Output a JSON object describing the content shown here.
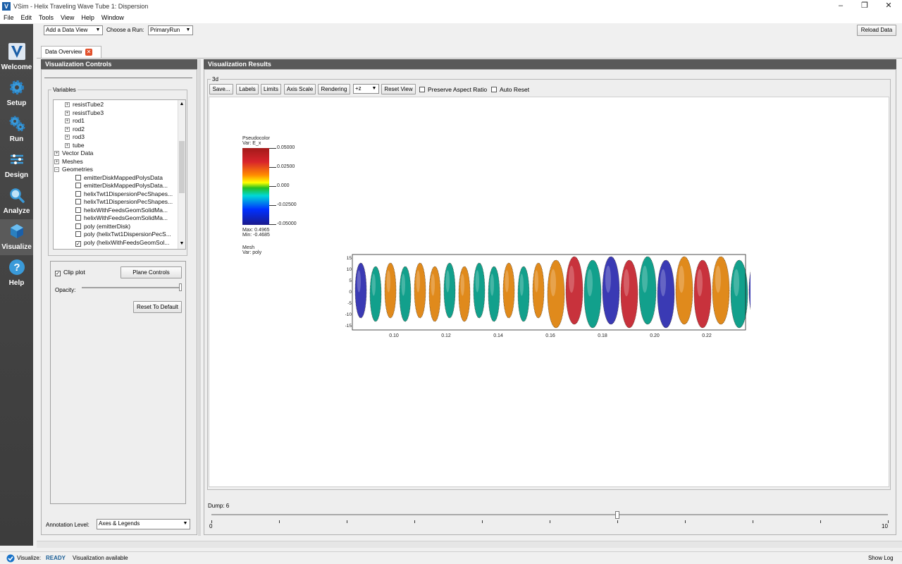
{
  "window": {
    "title": "VSim - Helix Traveling Wave Tube 1: Dispersion"
  },
  "menu": [
    "File",
    "Edit",
    "Tools",
    "View",
    "Help",
    "Window"
  ],
  "nav": [
    {
      "label": "Welcome",
      "icon": "vsim-logo-icon"
    },
    {
      "label": "Setup",
      "icon": "gear-icon"
    },
    {
      "label": "Run",
      "icon": "gears-icon"
    },
    {
      "label": "Design",
      "icon": "design-icon"
    },
    {
      "label": "Analyze",
      "icon": "magnifier-icon"
    },
    {
      "label": "Visualize",
      "icon": "cube-icon"
    },
    {
      "label": "Help",
      "icon": "question-icon"
    }
  ],
  "toolbar": {
    "add_data_view": "Add a Data View",
    "choose_run_label": "Choose a Run:",
    "run_value": "PrimaryRun",
    "reload": "Reload Data"
  },
  "tab": {
    "label": "Data Overview"
  },
  "controls": {
    "header": "Visualization Controls",
    "variables_title": "Variables",
    "tree": [
      {
        "label": "resistTube2",
        "type": "expand",
        "indent": 2
      },
      {
        "label": "resistTube3",
        "type": "expand",
        "indent": 2
      },
      {
        "label": "rod1",
        "type": "expand",
        "indent": 2
      },
      {
        "label": "rod2",
        "type": "expand",
        "indent": 2
      },
      {
        "label": "rod3",
        "type": "expand",
        "indent": 2
      },
      {
        "label": "tube",
        "type": "expand",
        "indent": 2
      },
      {
        "label": "Vector Data",
        "type": "expand",
        "indent": 0
      },
      {
        "label": "Meshes",
        "type": "expand",
        "indent": 0
      },
      {
        "label": "Geometries",
        "type": "collapse",
        "indent": 0
      },
      {
        "label": "emitterDiskMappedPolysData",
        "type": "check",
        "indent": 3,
        "checked": false
      },
      {
        "label": "emitterDiskMappedPolysData...",
        "type": "check",
        "indent": 3,
        "checked": false
      },
      {
        "label": "helixTwt1DispersionPecShapes...",
        "type": "check",
        "indent": 3,
        "checked": false
      },
      {
        "label": "helixTwt1DispersionPecShapes...",
        "type": "check",
        "indent": 3,
        "checked": false
      },
      {
        "label": "helixWithFeedsGeomSolidMa...",
        "type": "check",
        "indent": 3,
        "checked": false
      },
      {
        "label": "helixWithFeedsGeomSolidMa...",
        "type": "check",
        "indent": 3,
        "checked": false
      },
      {
        "label": "poly (emitterDisk)",
        "type": "check",
        "indent": 3,
        "checked": false
      },
      {
        "label": "poly (helixTwt1DispersionPecS...",
        "type": "check",
        "indent": 3,
        "checked": false
      },
      {
        "label": "poly (helixWithFeedsGeomSol...",
        "type": "check",
        "indent": 3,
        "checked": true
      }
    ],
    "clip_plot": "Clip plot",
    "plane_controls": "Plane Controls",
    "opacity_label": "Opacity:",
    "reset_default": "Reset To Default",
    "annotation_label": "Annotation Level:",
    "annotation_value": "Axes & Legends"
  },
  "results": {
    "header": "Visualization Results",
    "group_title": "3d",
    "buttons": {
      "save": "Save...",
      "labels": "Labels",
      "limits": "Limits",
      "axis_scale": "Axis Scale",
      "rendering": "Rendering",
      "reset_view": "Reset View"
    },
    "view_axis": "+z",
    "preserve_aspect": "Preserve Aspect Ratio",
    "auto_reset": "Auto Reset"
  },
  "legend": {
    "title": "Pseudocolor",
    "var": "Var: E_x",
    "ticks": [
      "0.05000",
      "0.02500",
      "0.000",
      "-0.02500",
      "-0.05000"
    ],
    "max": "Max: 0.4965",
    "min": "Min: -0.4685",
    "mesh_title": "Mesh",
    "mesh_var": "Var: poly"
  },
  "plot": {
    "x_ticks": [
      "0.10",
      "0.12",
      "0.14",
      "0.16",
      "0.18",
      "0.20",
      "0.22"
    ],
    "y_ticks": [
      "15",
      "10",
      "5",
      "0",
      "-5",
      "-10",
      "-15"
    ],
    "colors": {
      "red": "#c8323c",
      "orange": "#e08a1c",
      "teal": "#12a08c",
      "blue": "#3a3ab4"
    }
  },
  "dump": {
    "label": "Dump: 6",
    "min": "0",
    "max": "10",
    "value": 6
  },
  "status": {
    "prefix": "Visualize:",
    "state": "READY",
    "message": "Visualization available",
    "show_log": "Show Log"
  }
}
